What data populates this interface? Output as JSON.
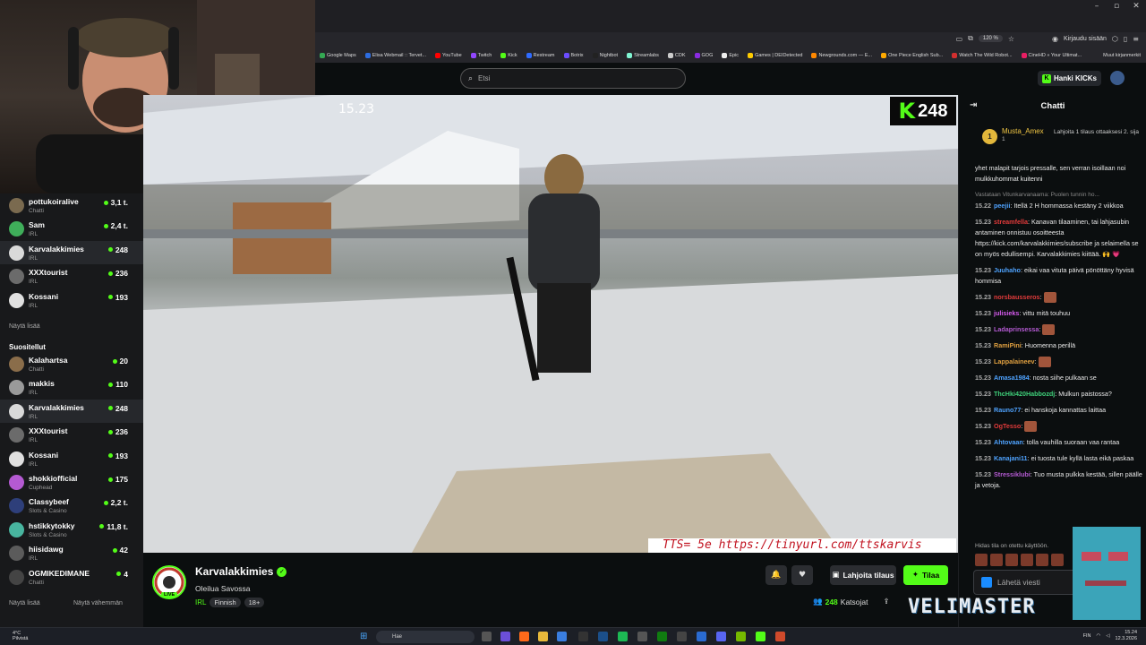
{
  "browser": {
    "zoom": "120 %",
    "login_label": "Kirjaudu sisään",
    "bookmarks": [
      {
        "label": "Google Maps",
        "color": "#34a853"
      },
      {
        "label": "Elisa Webmail :: Tervet...",
        "color": "#2d6cdf"
      },
      {
        "label": "YouTube",
        "color": "#ff0000"
      },
      {
        "label": "Twitch",
        "color": "#9146ff"
      },
      {
        "label": "Kick",
        "color": "#53fc18"
      },
      {
        "label": "Restream",
        "color": "#2f6bff"
      },
      {
        "label": "Botrix",
        "color": "#6b4cff"
      },
      {
        "label": "Nightbot",
        "color": "#222222"
      },
      {
        "label": "Streamlabs",
        "color": "#80f5d2"
      },
      {
        "label": "CDK",
        "color": "#cccccc"
      },
      {
        "label": "GOG",
        "color": "#8a2be2"
      },
      {
        "label": "Epic",
        "color": "#eeeeee"
      },
      {
        "label": "Games | DEIDetected",
        "color": "#ffcc00"
      },
      {
        "label": "Newgrounds.com — E...",
        "color": "#ff8800"
      },
      {
        "label": "One Piece English Sub...",
        "color": "#ffaa00"
      },
      {
        "label": "Watch The Wild Robot...",
        "color": "#d32f2f"
      },
      {
        "label": "CineHD » Your Ultimat...",
        "color": "#e91e63"
      }
    ],
    "bookmarks_more": "Muut kirjanmerkit"
  },
  "header": {
    "search_placeholder": "Etsi",
    "kicks_label": "Hanki KICKs"
  },
  "video": {
    "timestamp": "15.23",
    "viewer_count": "248",
    "tts_text": "TTS= 5e https://tinyurl.com/ttskarvis"
  },
  "sidebar": {
    "following": [
      {
        "name": "pottukoiralive",
        "category": "Chatti",
        "count": "3,1 t.",
        "color": "#7a6a4f"
      },
      {
        "name": "Sam",
        "category": "IRL",
        "count": "2,4 t.",
        "color": "#3fae5a"
      },
      {
        "name": "Karvalakkimies",
        "category": "IRL",
        "count": "248",
        "color": "#d9d9d9"
      },
      {
        "name": "XXXtourist",
        "category": "IRL",
        "count": "236",
        "color": "#6b6b6b"
      },
      {
        "name": "Kossani",
        "category": "IRL",
        "count": "193",
        "color": "#e0e0e0"
      }
    ],
    "show_more": "Näytä lisää",
    "recommended_title": "Suositellut",
    "recommended": [
      {
        "name": "Kalahartsa",
        "category": "Chatti",
        "count": "20",
        "color": "#8a6d4a"
      },
      {
        "name": "makkis",
        "category": "IRL",
        "count": "110",
        "color": "#9a9a9a"
      },
      {
        "name": "Karvalakkimies",
        "category": "IRL",
        "count": "248",
        "color": "#d9d9d9"
      },
      {
        "name": "XXXtourist",
        "category": "IRL",
        "count": "236",
        "color": "#6b6b6b"
      },
      {
        "name": "Kossani",
        "category": "IRL",
        "count": "193",
        "color": "#e0e0e0"
      },
      {
        "name": "shokkiofficial",
        "category": "Cuphead",
        "count": "175",
        "color": "#b45ad2"
      },
      {
        "name": "Classybeef",
        "category": "Slots & Casino",
        "count": "2,2 t.",
        "color": "#2e3f7a"
      },
      {
        "name": "hstikkytokky",
        "category": "Slots & Casino",
        "count": "11,8 t.",
        "color": "#48b59f"
      },
      {
        "name": "hiisidawg",
        "category": "IRL",
        "count": "42",
        "color": "#5b5b5b"
      },
      {
        "name": "OGMIKEDIMANE",
        "category": "Chatti",
        "count": "4",
        "color": "#444444"
      }
    ],
    "show_more2": "Näytä lisää",
    "show_less": "Näytä vähemmän"
  },
  "stream": {
    "channel": "Karvalakkimies",
    "live": "LIVE",
    "title": "Oleilua Savossa",
    "category": "IRL",
    "tags": [
      "Finnish",
      "18+"
    ],
    "gift_label": "Lahjoita tilaus",
    "subscribe_label": "Tilaa",
    "viewers": "248",
    "viewers_label": "Katsojat"
  },
  "chat": {
    "title": "Chatti",
    "pinned": {
      "rank": "1",
      "name": "Musta_Amex",
      "sub": "1",
      "note": "Lahjoita 1 tilaus ottaaksesi 2. sija"
    },
    "top_text": "yhet malapit tarjois pressalle, sen verran isoillaan noi mulkkuhommat kuitenni",
    "reply_text": "Vastataan Vitunkarvanaama: Puolen tunnin ho...",
    "messages": [
      {
        "time": "15.22",
        "user": "peejii",
        "color": "#4fa3ff",
        "text": "Itellä 2 H hommassa kestäny 2 viikkoa"
      },
      {
        "time": "15.23",
        "user": "streamfella",
        "color": "#e23b3b",
        "text": "Kanavan tilaaminen, tai lahjasubin antaminen onnistuu osoitteesta https://kick.com/karvalakkimies/subscribe ja selaimella se on myös edullisempi. Karvalakkimies kiittää. 🙌 💗"
      },
      {
        "time": "15.23",
        "user": "Juuhaho",
        "color": "#4fa3ff",
        "text": "eikai vaa vituta   päivä pönöttäny hyvisä hommisa"
      },
      {
        "time": "15.23",
        "user": "norsbausseros",
        "color": "#e23b3b",
        "text": ""
      },
      {
        "time": "15.23",
        "user": "julisieks",
        "color": "#d85cf0",
        "text": "vittu mitä touhuu"
      },
      {
        "time": "15.23",
        "user": "Ladaprinsessa",
        "color": "#b45ad2",
        "text": ""
      },
      {
        "time": "15.23",
        "user": "RamiPini",
        "color": "#e0a040",
        "text": "Huomenna perillä"
      },
      {
        "time": "15.23",
        "user": "Lappalaineev",
        "color": "#e0a040",
        "text": ""
      },
      {
        "time": "15.23",
        "user": "Amasa1984",
        "color": "#4fa3ff",
        "text": "nosta siihe pulkaan se"
      },
      {
        "time": "15.23",
        "user": "ThcHki420Habbozdj",
        "color": "#3fd07a",
        "text": "Mulkun paistossa?"
      },
      {
        "time": "15.23",
        "user": "Rauno77",
        "color": "#4fa3ff",
        "text": "ei hanskoja kannattas laittaa"
      },
      {
        "time": "15.23",
        "user": "OgTesso",
        "color": "#e23b3b",
        "text": ""
      },
      {
        "time": "15.23",
        "user": "Ahtovaan",
        "color": "#4fa3ff",
        "text": "tolla vauhilla suoraan vaa rantaa"
      },
      {
        "time": "15.23",
        "user": "Kanajani11",
        "color": "#4fa3ff",
        "text": "ei tuosta tule kyllä lasta eikä paskaa"
      },
      {
        "time": "15.23",
        "user": "Stressiklubi",
        "color": "#b45ad2",
        "text": "Tuo musta pulkka kestää, sillen päälle ja vetoja."
      }
    ],
    "slow_mode": "Hidas tila on otettu käyttöön.",
    "input_placeholder": "Lähetä viesti"
  },
  "overlay": {
    "brand": "VELIMASTER"
  },
  "taskbar": {
    "temp": "4°C",
    "weather": "Pilvistä",
    "search_placeholder": "Hae",
    "lang": "FIN",
    "time": "15.24",
    "date": "12.3.2026"
  }
}
